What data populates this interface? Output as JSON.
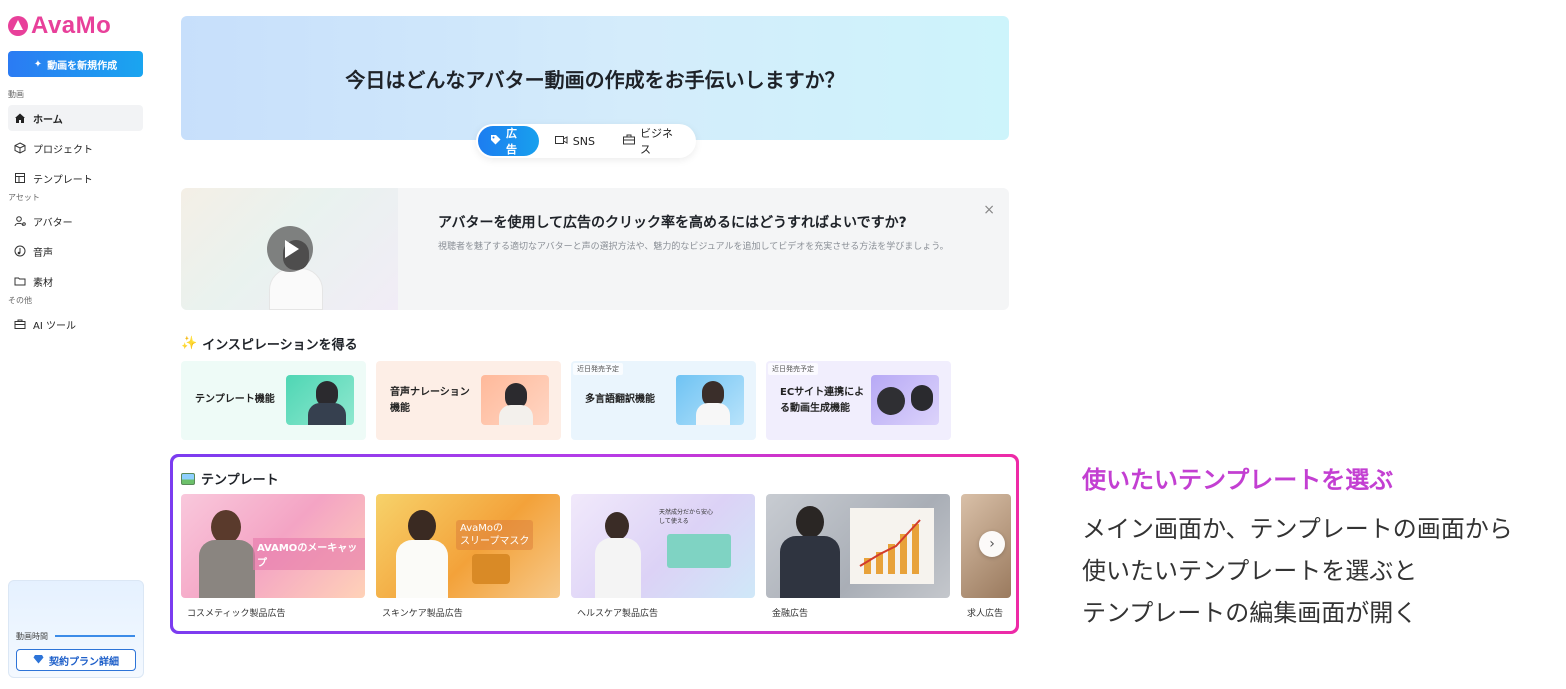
{
  "app": {
    "logo_text": "AvaMo",
    "brand_color": "#e8409a"
  },
  "sidebar": {
    "new_video_label": "動画を新規作成",
    "sections": {
      "video": "動画",
      "assets": "アセット",
      "other": "その他"
    },
    "items": [
      {
        "label": "ホーム",
        "icon": "home-icon",
        "active": true
      },
      {
        "label": "プロジェクト",
        "icon": "cube-icon"
      },
      {
        "label": "テンプレート",
        "icon": "template-icon"
      },
      {
        "label": "アバター",
        "icon": "avatar-icon"
      },
      {
        "label": "音声",
        "icon": "audio-icon"
      },
      {
        "label": "素材",
        "icon": "folder-icon"
      },
      {
        "label": "AI ツール",
        "icon": "toolbox-icon"
      }
    ],
    "plan": {
      "time_label": "動画時間",
      "button_label": "契約プラン詳細"
    }
  },
  "hero": {
    "title": "今日はどんなアバター動画の作成をお手伝いしますか？",
    "tabs": [
      {
        "label": "広告",
        "icon": "tag-icon",
        "active": true
      },
      {
        "label": "SNS",
        "icon": "video-camera-icon"
      },
      {
        "label": "ビジネス",
        "icon": "briefcase-icon"
      }
    ]
  },
  "tip": {
    "title": "アバターを使用して広告のクリック率を高めるにはどうすればよいですか?",
    "description": "視聴者を魅了する適切なアバターと声の選択方法や、魅力的なビジュアルを追加してビデオを充実させる方法を学びましょう。",
    "close": "×"
  },
  "inspiration": {
    "heading": "インスピレーションを得る",
    "cards": [
      {
        "label_lines": [
          "テンプレート機能"
        ],
        "badge": ""
      },
      {
        "label_lines": [
          "音声ナレーション",
          "機能"
        ],
        "badge": ""
      },
      {
        "label_lines": [
          "多言語翻訳機能"
        ],
        "badge": "近日発売予定"
      },
      {
        "label_lines": [
          "ECサイト連携によ",
          "る動画生成機能"
        ],
        "badge": "近日発売予定"
      }
    ]
  },
  "templates": {
    "heading": "テンプレート",
    "cards": [
      {
        "caption": "コスメティック製品広告",
        "overlay": "AVAMOのメーキャップ"
      },
      {
        "caption": "スキンケア製品広告",
        "overlay": "AvaMoの\nスリープマスク"
      },
      {
        "caption": "ヘルスケア製品広告",
        "overlay": "天然成分だから安心\nして使える"
      },
      {
        "caption": "金融広告",
        "overlay": ""
      },
      {
        "caption": "求人広告",
        "overlay": ""
      }
    ]
  },
  "annotation": {
    "title": "使いたいテンプレートを選ぶ",
    "lines": [
      "メイン画面か、テンプレートの画面から",
      "使いたいテンプレートを選ぶと",
      "テンプレートの編集画面が開く"
    ],
    "title_color": "#c33fd2"
  }
}
